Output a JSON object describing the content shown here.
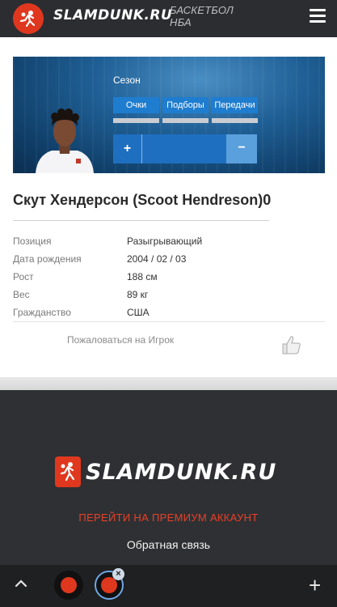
{
  "header": {
    "logo_text": "SLAMDUNK.RU",
    "subtitle_line1": "БАСКЕТБОЛ",
    "subtitle_line2": "НБА",
    "menu_icon": "hamburger-menu-icon"
  },
  "banner": {
    "season_label": "Сезон",
    "stat_tabs": [
      "Очки",
      "Подборы",
      "Передачи"
    ],
    "vote_plus": "+",
    "vote_minus": "−"
  },
  "player": {
    "name": "Скут Хендерсон (Scoot Hendreson)0",
    "info": [
      {
        "label": "Позиция",
        "value": "Разыгрывающий"
      },
      {
        "label": "Дата рождения",
        "value": "2004 / 02 / 03"
      },
      {
        "label": "Рост",
        "value": "188 см"
      },
      {
        "label": "Вес",
        "value": "89 кг"
      },
      {
        "label": "Гражданство",
        "value": "США"
      }
    ],
    "report_link": "Пожаловаться на Игрок",
    "like_icon": "thumbs-up-icon"
  },
  "footer": {
    "logo_text": "SLAMDUNK.RU",
    "premium_link": "ПЕРЕЙТИ НА ПРЕМИУМ АККАУНТ",
    "feedback_link": "Обратная связь"
  },
  "bottombar": {
    "close_symbol": "×",
    "new_tab_symbol": "+"
  },
  "colors": {
    "brand_red": "#e0371f",
    "header_bg": "#2b2d31",
    "accent_blue": "#1f7dcf"
  }
}
